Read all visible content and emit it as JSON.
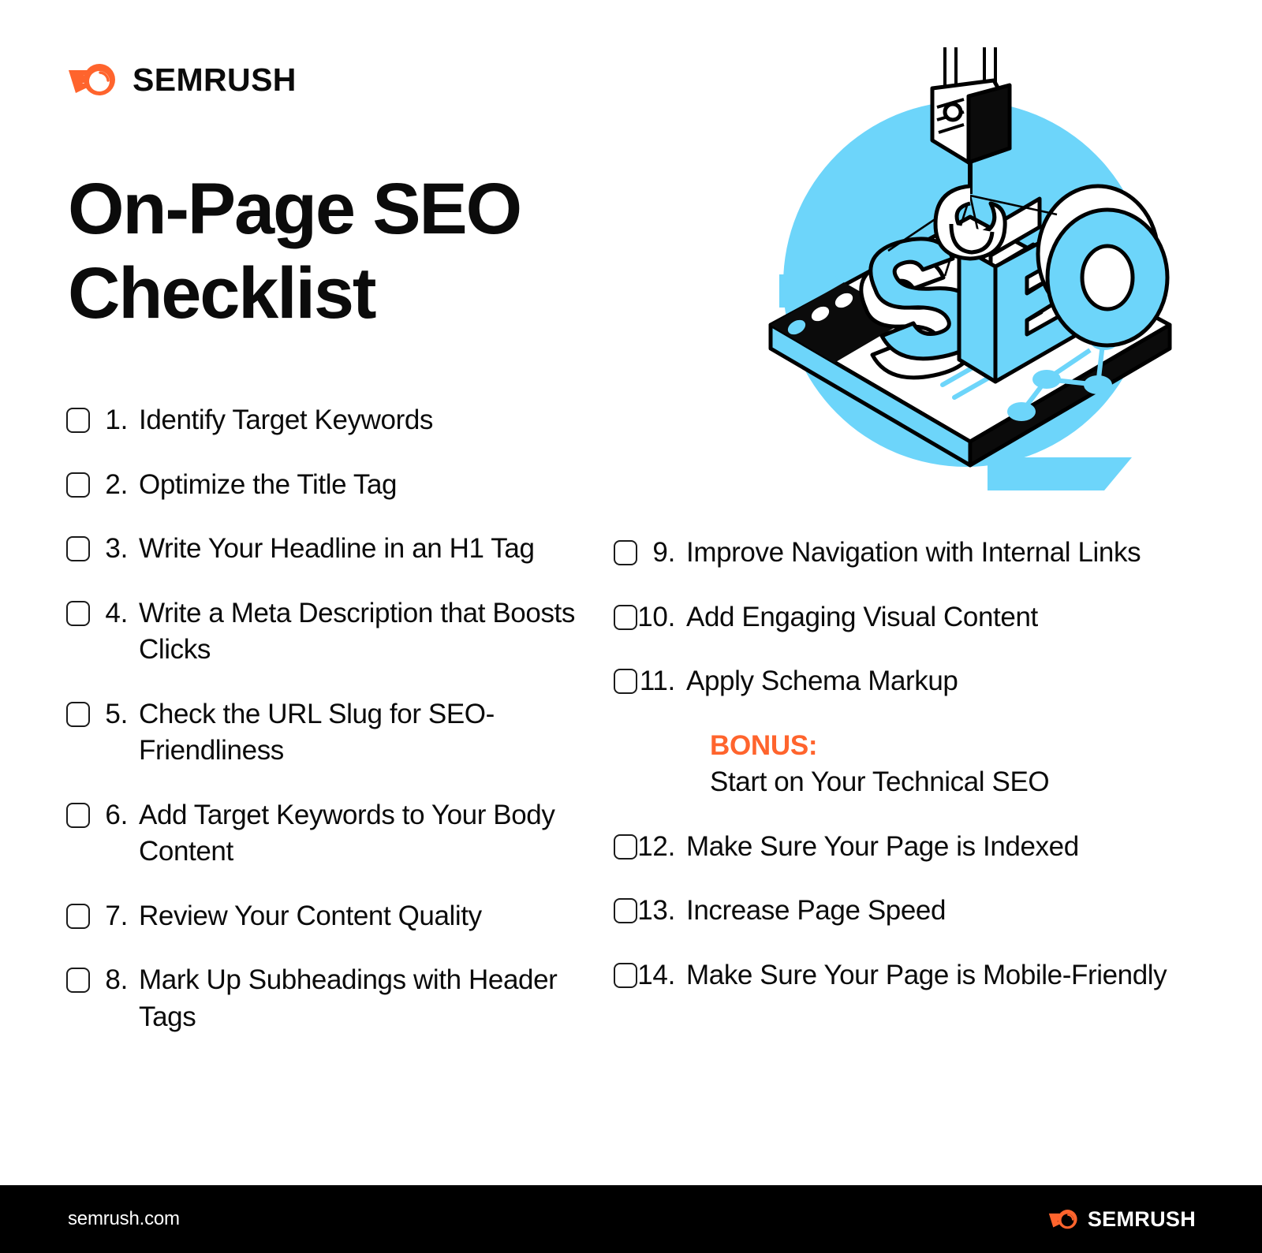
{
  "brand": {
    "name": "SEMRUSH",
    "mark_icon": "semrush-comet-icon"
  },
  "title": {
    "line1": "On-Page SEO",
    "line2": "Checklist"
  },
  "hero": {
    "illustration_name": "seo-crane-tablet-illustration",
    "word": "SEO",
    "colors": {
      "blue": "#6DD5FA",
      "black": "#000000",
      "white": "#FFFFFF"
    }
  },
  "colors": {
    "accent_orange": "#FF642D",
    "text": "#0B0B0B",
    "footer_bg": "#000000",
    "background": "#FFFFFF"
  },
  "checklist": {
    "left_column": [
      {
        "number": "1.",
        "label": "Identify Target Keywords"
      },
      {
        "number": "2.",
        "label": "Optimize the Title Tag"
      },
      {
        "number": "3.",
        "label": "Write Your Headline in an H1 Tag"
      },
      {
        "number": "4.",
        "label": "Write a Meta Description that Boosts Clicks"
      },
      {
        "number": "5.",
        "label": "Check the URL Slug for SEO-Friendliness"
      },
      {
        "number": "6.",
        "label": "Add Target Keywords to Your Body Content"
      },
      {
        "number": "7.",
        "label": "Review Your Content Quality"
      },
      {
        "number": "8.",
        "label": "Mark Up Subheadings with Header Tags"
      }
    ],
    "right_column_top": [
      {
        "number": "9.",
        "label": "Improve Navigation with Internal Links"
      },
      {
        "number": "10.",
        "label": "Add Engaging Visual Content"
      },
      {
        "number": "11.",
        "label": "Apply Schema Markup"
      }
    ],
    "bonus": {
      "tag": "BONUS:",
      "text": "Start on Your Technical SEO"
    },
    "right_column_bottom": [
      {
        "number": "12.",
        "label": "Make Sure Your Page is Indexed"
      },
      {
        "number": "13.",
        "label": "Increase Page Speed"
      },
      {
        "number": "14.",
        "label": "Make Sure Your Page is Mobile-Friendly"
      }
    ]
  },
  "footer": {
    "url": "semrush.com",
    "brand_name": "SEMRUSH",
    "mark_icon": "semrush-comet-icon"
  }
}
